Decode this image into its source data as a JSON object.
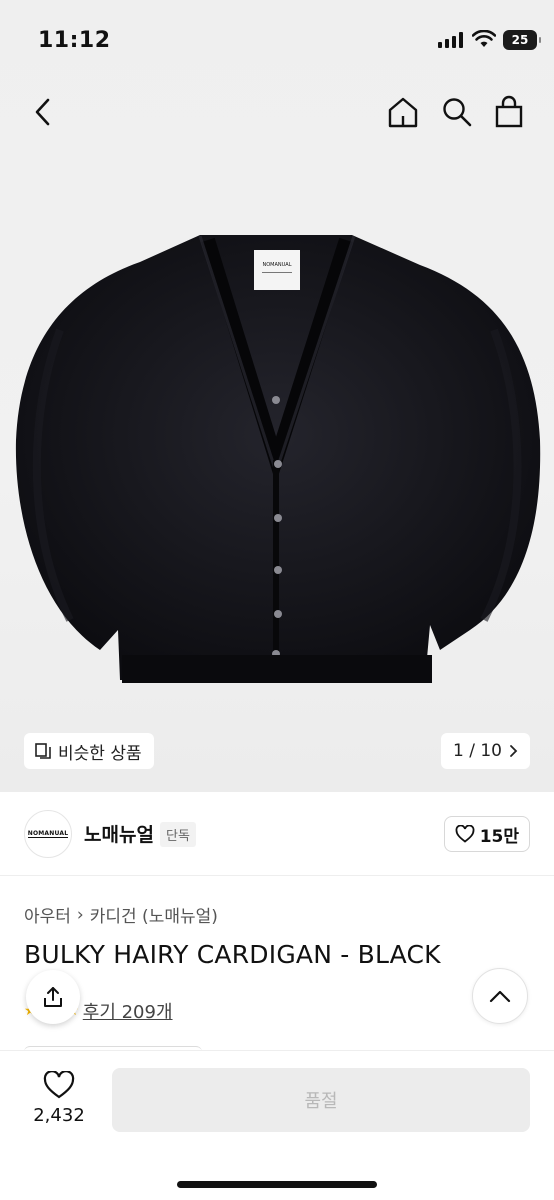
{
  "status_bar": {
    "time": "11:12",
    "battery": "25"
  },
  "gallery": {
    "similar_label": "비슷한 상품",
    "page_indicator": "1 / 10",
    "garment_label": "NOMANUAL"
  },
  "brand": {
    "name": "노매뉴얼",
    "tag": "단독",
    "logo_text": "NOMANUAL",
    "likes": "15만"
  },
  "product": {
    "breadcrumbs": [
      "아우터",
      "카디건 (노매뉴얼)"
    ],
    "title": "BULKY HAIRY CARDIGAN - BLACK",
    "review_link": "후기 209개",
    "rating_stars": "★★★★★"
  },
  "bottom_bar": {
    "favorite_count": "2,432",
    "buy_label": "품절"
  },
  "icons": [
    "back-icon",
    "home-icon",
    "search-icon",
    "shopping-bag-icon",
    "similar-items-icon",
    "chevron-right-icon",
    "heart-icon",
    "share-icon",
    "chevron-up-icon"
  ]
}
